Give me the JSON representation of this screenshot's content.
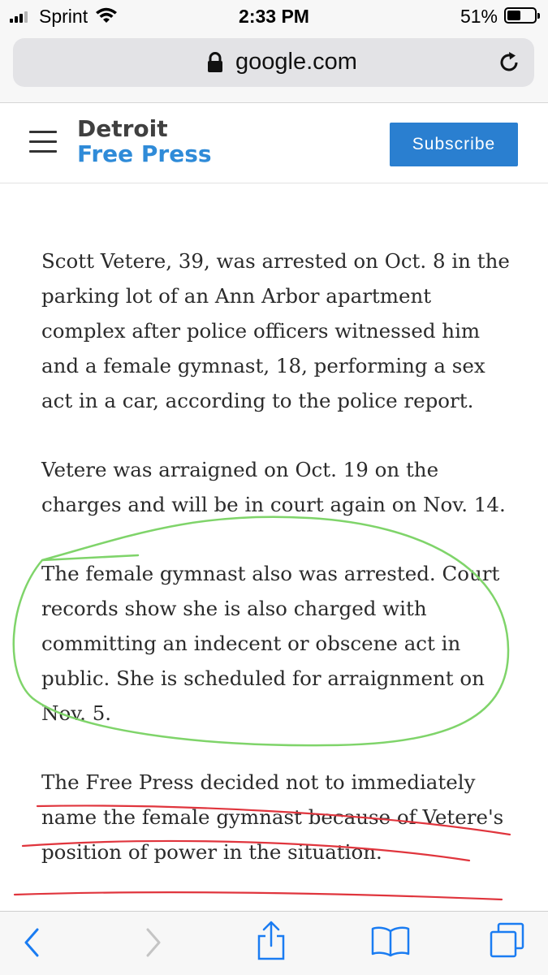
{
  "status_bar": {
    "carrier": "Sprint",
    "time": "2:33 PM",
    "battery_percent": "51%",
    "battery_level": 0.51,
    "signal_bars": 3
  },
  "browser": {
    "url": "google.com",
    "icons": {
      "lock": "lock-icon",
      "reload": "reload-icon"
    }
  },
  "site": {
    "brand_line1": "Detroit",
    "brand_line2": "Free Press",
    "subscribe_label": "Subscribe",
    "brand_colors": {
      "detroit": "#404040",
      "free_press": "#2f8bd8",
      "subscribe_bg": "#2a7fd0"
    }
  },
  "article": {
    "paragraphs": [
      "Scott Vetere, 39, was arrested on Oct. 8 in the parking lot of an Ann Arbor apartment complex after police officers witnessed him and a female gymnast, 18, performing a sex act in a car, according to the police report.",
      "Vetere was arraigned on Oct. 19 on the charges and will be in court again on Nov. 14.",
      "The female gymnast also was arrested. Court records show she is also charged with committing an indecent or obscene act in public. She is scheduled for arraignment on Nov. 5.",
      "The Free Press decided not to immediately name the female gymnast because of Vetere's position of power in the situation."
    ]
  },
  "annotations": {
    "circle_color": "#7fd46a",
    "underline_color": "#e0353d"
  },
  "toolbar": {
    "icons": [
      "back-icon",
      "forward-icon",
      "share-icon",
      "bookmarks-icon",
      "tabs-icon"
    ],
    "accent_color": "#1a7cf2"
  }
}
